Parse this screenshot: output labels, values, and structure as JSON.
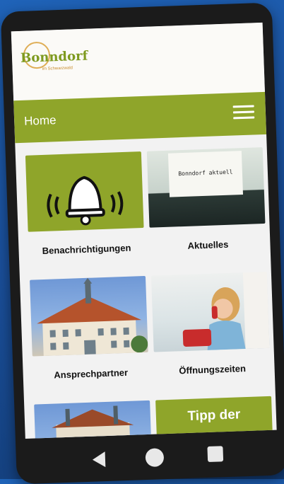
{
  "logo": {
    "text": "Bonndorf",
    "subtitle": "im Schwarzwald"
  },
  "header": {
    "title": "Home"
  },
  "tiles": [
    {
      "label": "Benachrichtigungen",
      "icon": "bell-icon"
    },
    {
      "label": "Aktuelles",
      "paper_text": "Bonndorf aktuell"
    },
    {
      "label": "Ansprechpartner"
    },
    {
      "label": "Öffnungszeiten"
    },
    {
      "label": ""
    },
    {
      "label": "Tipp der"
    }
  ],
  "navbar": {
    "back": "back-icon",
    "home": "home-icon",
    "recent": "recent-apps-icon"
  },
  "colors": {
    "accent": "#8fa52a",
    "phone": "#1b1b1b",
    "background": "#1a4f9a"
  }
}
